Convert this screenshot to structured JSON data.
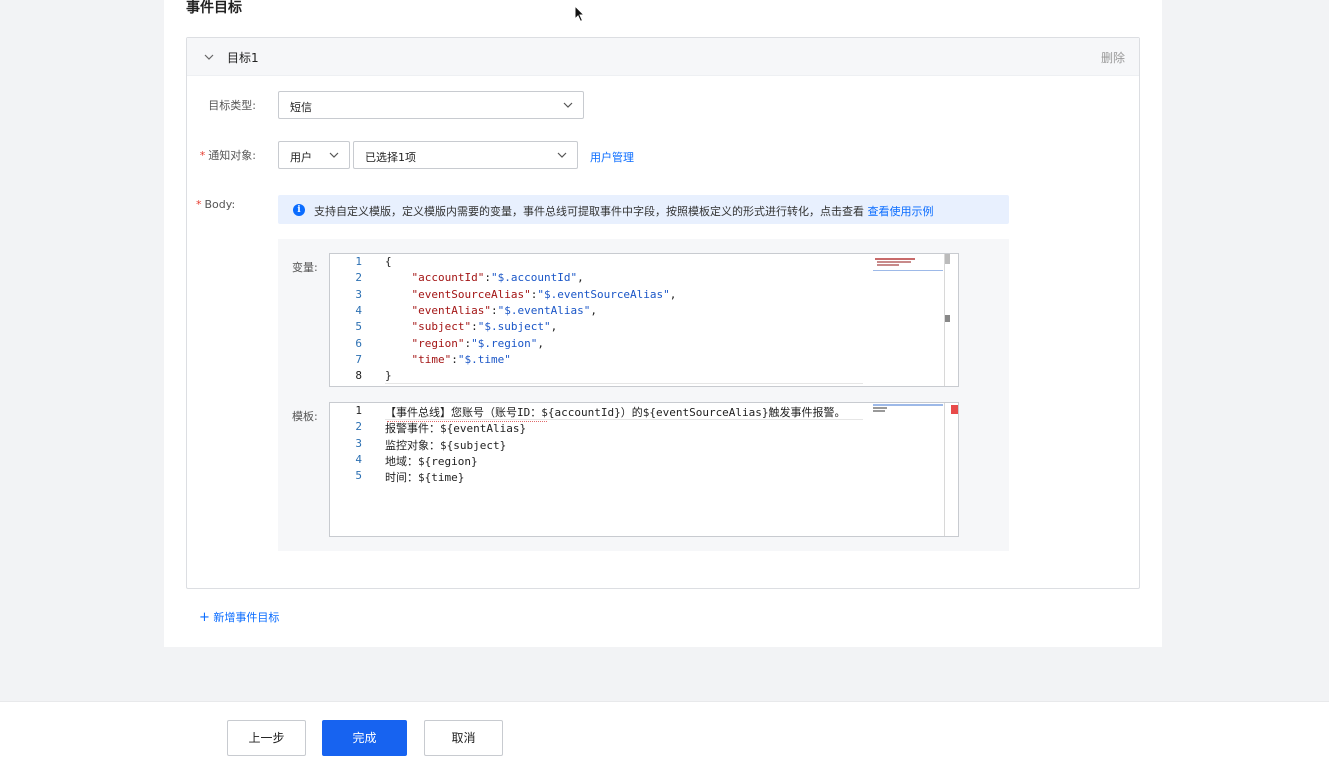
{
  "section_title": "事件目标",
  "target": {
    "title": "目标1",
    "delete_label": "删除",
    "type_label": "目标类型:",
    "type_value": "短信",
    "notify_label": "通知对象:",
    "notify_kind": "用户",
    "notify_selected": "已选择1项",
    "user_manage_link": "用户管理",
    "body_label": "Body:",
    "info_text": "支持自定义模版，定义模版内需要的变量，事件总线可提取事件中字段，按照模板定义的形式进行转化，点击查看",
    "info_link": "查看使用示例",
    "variables_label": "变量:",
    "variables_lines": [
      {
        "n": "1",
        "code": "{"
      },
      {
        "n": "2",
        "key": "\"accountId\"",
        "val": "\"$.accountId\"",
        "tail": ","
      },
      {
        "n": "3",
        "key": "\"eventSourceAlias\"",
        "val": "\"$.eventSourceAlias\"",
        "tail": ","
      },
      {
        "n": "4",
        "key": "\"eventAlias\"",
        "val": "\"$.eventAlias\"",
        "tail": ","
      },
      {
        "n": "5",
        "key": "\"subject\"",
        "val": "\"$.subject\"",
        "tail": ","
      },
      {
        "n": "6",
        "key": "\"region\"",
        "val": "\"$.region\"",
        "tail": ","
      },
      {
        "n": "7",
        "key": "\"time\"",
        "val": "\"$.time\"",
        "tail": ""
      },
      {
        "n": "8",
        "code": "}"
      }
    ],
    "template_label": "模板:",
    "template_lines": [
      {
        "n": "1",
        "code": "【事件总线】您账号（账号ID：${accountId}）的${eventSourceAlias}触发事件报警。"
      },
      {
        "n": "2",
        "code": "报警事件：${eventAlias}"
      },
      {
        "n": "3",
        "code": "监控对象：${subject}"
      },
      {
        "n": "4",
        "code": "地域：${region}"
      },
      {
        "n": "5",
        "code": "时间：${time}"
      }
    ]
  },
  "add_target_label": "新增事件目标",
  "footer": {
    "prev_label": "上一步",
    "finish_label": "完成",
    "cancel_label": "取消"
  },
  "colors": {
    "primary": "#1763f0",
    "link": "#0a6cff",
    "required": "#e63b2e"
  }
}
